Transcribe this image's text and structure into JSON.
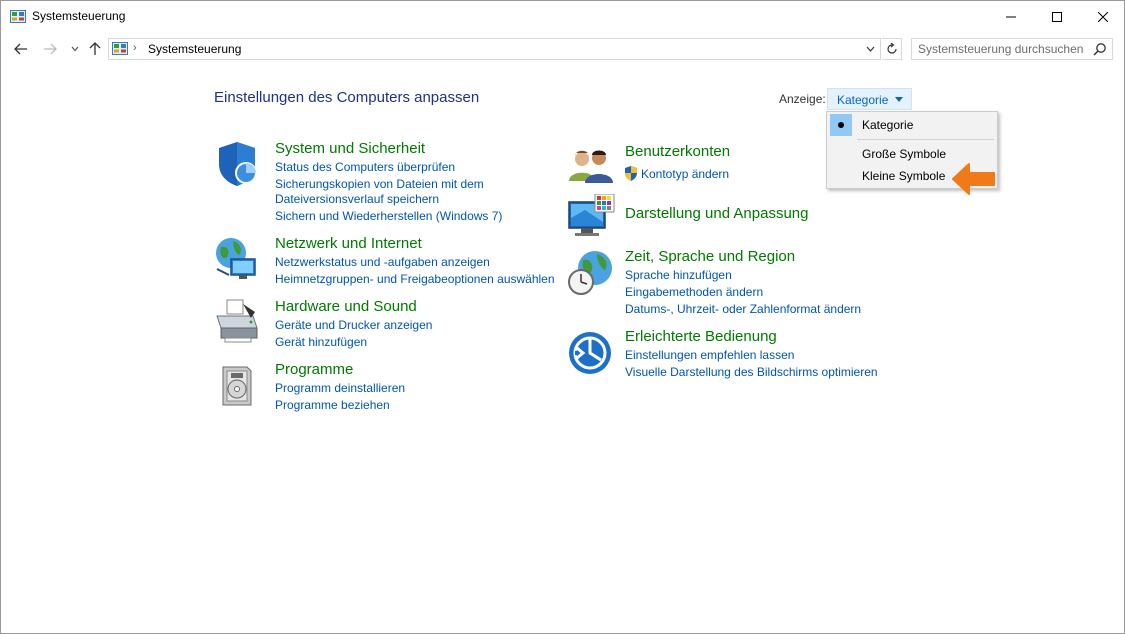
{
  "window": {
    "title": "Systemsteuerung"
  },
  "address": {
    "path": "Systemsteuerung",
    "search_placeholder": "Systemsteuerung durchsuchen"
  },
  "main": {
    "heading": "Einstellungen des Computers anpassen",
    "view_label": "Anzeige:",
    "view_value": "Kategorie",
    "view_menu": [
      "Kategorie",
      "Große Symbole",
      "Kleine Symbole"
    ]
  },
  "categories_left": [
    {
      "title": "System und Sicherheit",
      "links": [
        "Status des Computers überprüfen",
        "Sicherungskopien von Dateien mit dem",
        "Dateiversionsverlauf speichern",
        "Sichern und Wiederherstellen (Windows 7)"
      ],
      "icon": "shield-icon"
    },
    {
      "title": "Netzwerk und Internet",
      "links": [
        "Netzwerkstatus und -aufgaben anzeigen",
        "Heimnetzgruppen- und Freigabeoptionen auswählen"
      ],
      "icon": "network-globe-icon"
    },
    {
      "title": "Hardware und Sound",
      "links": [
        "Geräte und Drucker anzeigen",
        "Gerät hinzufügen"
      ],
      "icon": "printer-icon"
    },
    {
      "title": "Programme",
      "links": [
        "Programm deinstallieren",
        "Programme beziehen"
      ],
      "icon": "programs-disc-icon"
    }
  ],
  "categories_right": [
    {
      "title": "Benutzerkonten",
      "links": [
        "Kontotyp ändern"
      ],
      "icon": "users-icon"
    },
    {
      "title": "Darstellung und Anpassung",
      "links": [],
      "icon": "monitor-palette-icon"
    },
    {
      "title": "Zeit, Sprache und Region",
      "links": [
        "Sprache hinzufügen",
        "Eingabemethoden ändern",
        "Datums-, Uhrzeit- oder Zahlenformat ändern"
      ],
      "icon": "clock-globe-icon"
    },
    {
      "title": "Erleichterte Bedienung",
      "links": [
        "Einstellungen empfehlen lassen",
        "Visuelle Darstellung des Bildschirms optimieren"
      ],
      "icon": "ease-of-access-icon"
    }
  ],
  "colors": {
    "heading": "#1e3287",
    "category_title": "#007a00",
    "link": "#0055b3",
    "menu_highlight": "#90c8f6",
    "arrow": "#f07a1a"
  }
}
